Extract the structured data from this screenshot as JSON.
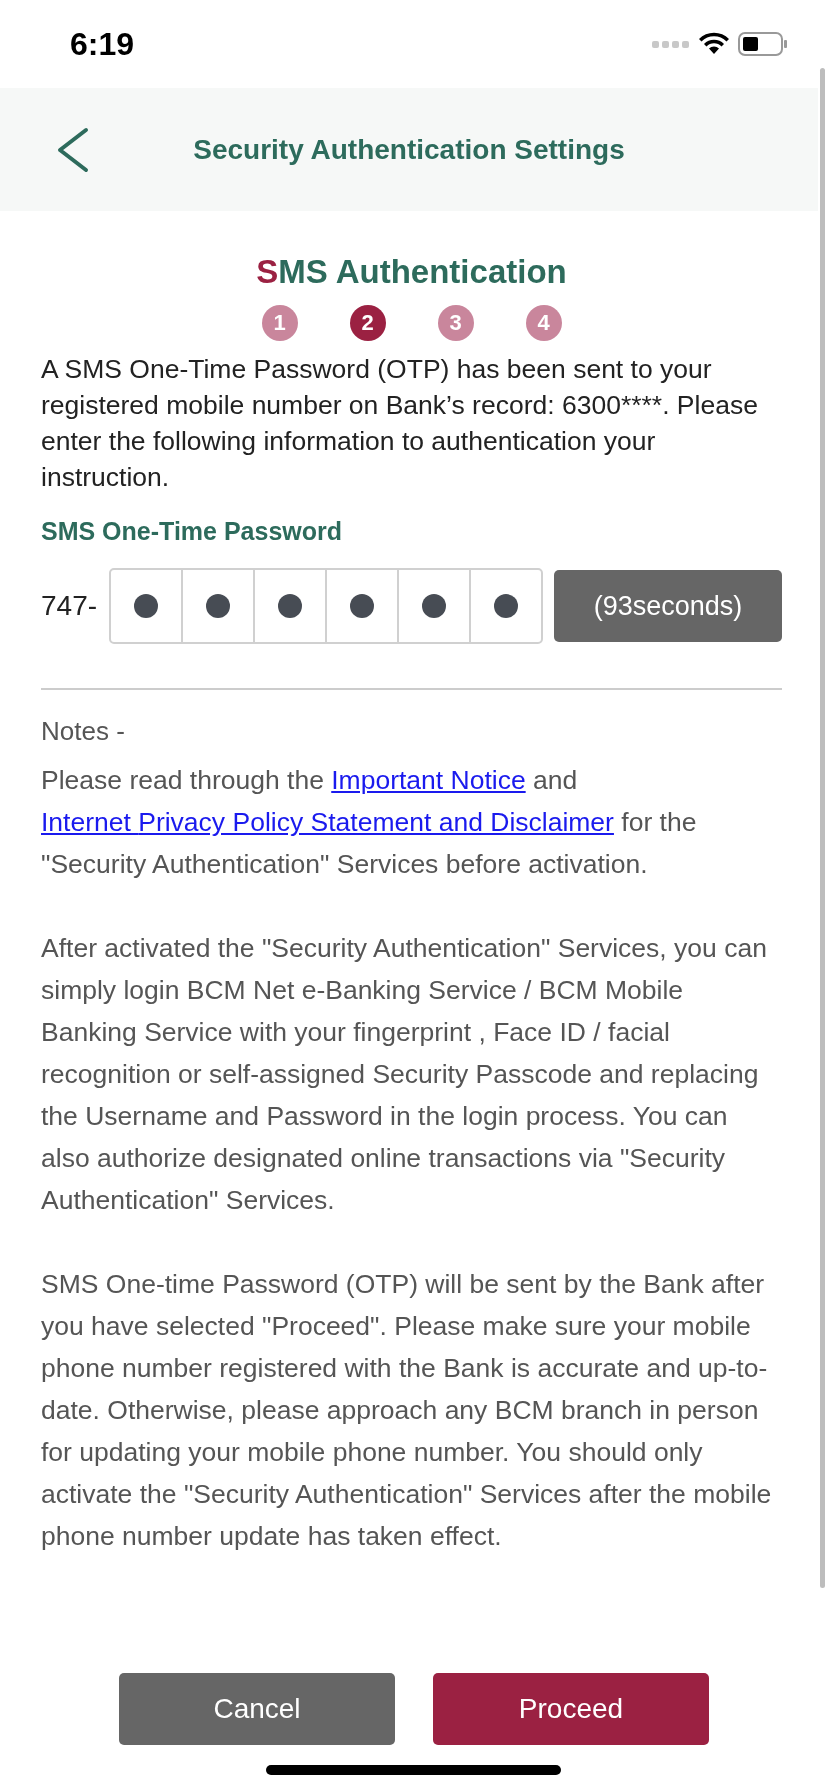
{
  "status_bar": {
    "time": "6:19"
  },
  "header": {
    "title": "Security Authentication Settings"
  },
  "section": {
    "title": "SMS Authentication"
  },
  "steps": [
    {
      "label": "1",
      "selected": false
    },
    {
      "label": "2",
      "selected": true
    },
    {
      "label": "3",
      "selected": false
    },
    {
      "label": "4",
      "selected": false
    }
  ],
  "intro": "A SMS One-Time Password (OTP) has been sent to your registered mobile number on Bank’s record: 6300****. Please enter the following information to authentication your instruction.",
  "otp": {
    "label": "SMS One-Time Password",
    "prefix": "747-",
    "digits": [
      {
        "filled": true
      },
      {
        "filled": true
      },
      {
        "filled": true
      },
      {
        "filled": true
      },
      {
        "filled": true
      },
      {
        "filled": true
      }
    ],
    "timer": "(93seconds)"
  },
  "notes": {
    "heading": "Notes -",
    "paragraphs": [
      [
        {
          "kind": "text",
          "text": "Please read through the "
        },
        {
          "kind": "link",
          "text": "Important Notice"
        },
        {
          "kind": "text",
          "text": " and "
        },
        {
          "kind": "link",
          "text": "Internet "
        },
        {
          "kind": "link",
          "text": "Privacy Policy Statement and Disclaimer"
        },
        {
          "kind": "text",
          "text": " for the \"Security Authentication\" Services before activation."
        }
      ],
      [
        {
          "kind": "text",
          "text": "After activated the \"Security Authentication\" Services, you can simply login BCM Net e-Banking Service / BCM Mobile Banking Service with your fingerprint , Face ID / facial recognition or self-assigned Security Passcode and replacing the Username and Password in the login process. You can also authorize designated online transactions via \"Security Authentication\" Services."
        }
      ],
      [
        {
          "kind": "text",
          "text": "SMS One-time Password (OTP) will be sent by the Bank after you have selected \"Proceed\". Please make sure your mobile phone number registered with the Bank is accurate and up-to-date. Otherwise, please approach any BCM branch in person for updating your mobile phone number. You should only activate the \"Security Authentication\" Services after the mobile phone number update has taken effect."
        }
      ]
    ]
  },
  "buttons": [
    {
      "label": "Cancel",
      "kind": "secondary"
    },
    {
      "label": "Proceed",
      "kind": "primary"
    }
  ]
}
